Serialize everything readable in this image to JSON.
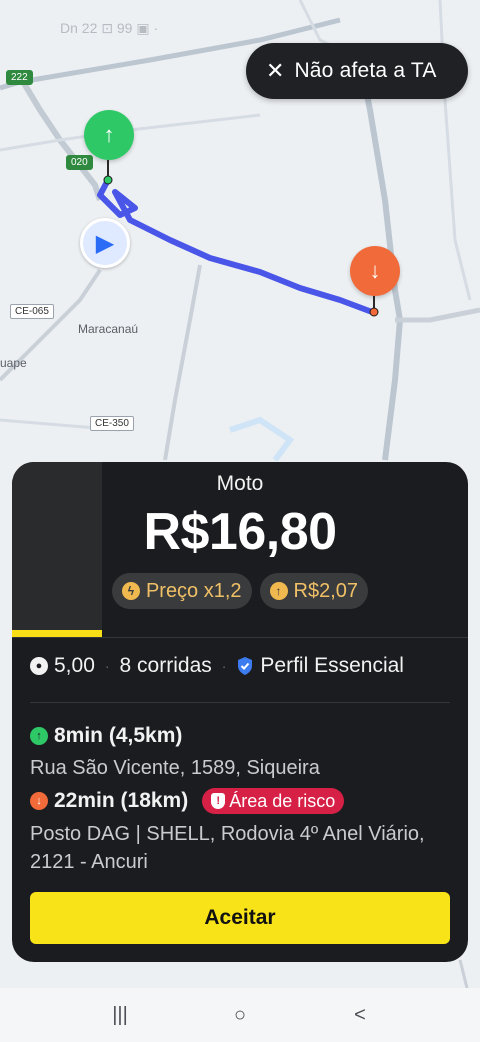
{
  "status_bar": {
    "text": "Dn 22 ⊡ 99 ▣ ·"
  },
  "dismiss_pill": {
    "icon": "close-icon",
    "label": "Não afeta a TA"
  },
  "map": {
    "road_labels": [
      "222",
      "020",
      "CE-065",
      "CE-350"
    ],
    "places": [
      "Maracanaú",
      "uape"
    ],
    "pickup_pin_icon": "arrow-up-icon",
    "dropoff_pin_icon": "arrow-down-icon",
    "nav_marker_icon": "navigation-arrow-icon",
    "colors": {
      "route": "#4a56e8",
      "pickup": "#2fc867",
      "dropoff": "#f06a3a"
    }
  },
  "offer": {
    "ride_type": "Moto",
    "price": "R$16,80",
    "tags": [
      {
        "icon": "lightning-icon",
        "label": "Preço x1,2"
      },
      {
        "icon": "arrow-up-circle-icon",
        "label": "R$2,07"
      }
    ],
    "rating": "5,00",
    "rides": "8 corridas",
    "profile": "Perfil Essencial",
    "pickup": {
      "eta": "8min (4,5km)",
      "address": "Rua São Vicente, 1589, Siqueira"
    },
    "dropoff": {
      "eta": "22min (18km)",
      "risk_label": "Área de risco",
      "address": "Posto DAG | SHELL, Rodovia 4º Anel Viário, 2121 - Ancuri"
    },
    "accept_label": "Aceitar",
    "colors": {
      "accent": "#f8e318",
      "card": "#1b1c20",
      "risk": "#d72046"
    }
  },
  "navbar": {
    "recents": "|||",
    "home": "○",
    "back": "<"
  }
}
